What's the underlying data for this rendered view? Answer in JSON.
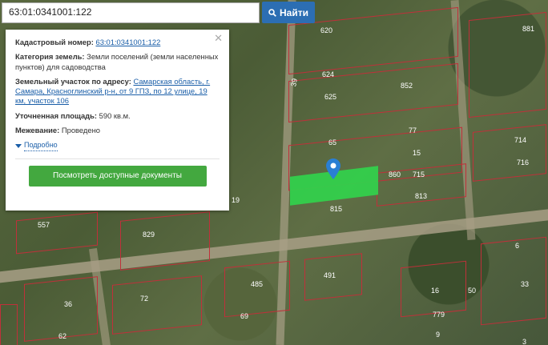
{
  "search": {
    "value": "63:01:0341001:122",
    "button_label": "Найти"
  },
  "card": {
    "cadastral_label": "Кадастровый номер:",
    "cadastral_value": "63:01:0341001:122",
    "category_label": "Категория земель:",
    "category_value": "Земли поселений (земли населенных пунктов) для садоводства",
    "address_label": "Земельный участок по адресу:",
    "address_value": "Самарская область, г. Самара, Красноглинский р-н, от 9 ГПЗ, по 12 улице, 19 км, участок 106",
    "area_label": "Уточненная площадь:",
    "area_value": "590 кв.м.",
    "survey_label": "Межевание:",
    "survey_value": "Проведено",
    "more_label": "Подробно",
    "docs_button": "Посмотреть доступные документы"
  },
  "map": {
    "plot_numbers": [
      "620",
      "624",
      "625",
      "881",
      "852",
      "714",
      "716",
      "77",
      "15",
      "860",
      "715",
      "813",
      "815",
      "65",
      "557",
      "829",
      "6",
      "485",
      "491",
      "33",
      "36",
      "72",
      "69",
      "779",
      "62",
      "9",
      "3",
      "16",
      "50",
      "39",
      "19"
    ]
  },
  "colors": {
    "highlight": "#33d04c",
    "button_blue": "#2c6eb3",
    "button_green": "#43a83f",
    "parcel_border": "#c0303a"
  }
}
